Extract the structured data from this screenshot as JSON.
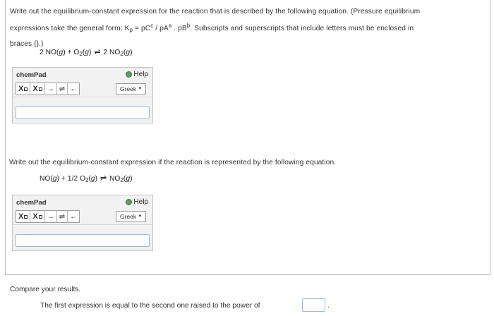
{
  "question1": {
    "part1": "Write out the equilibrium-constant expression for the reaction that is described by the following equation. (Pressure equilibrium",
    "part2_prefix": "expressions take the general form: K",
    "kp_sub": "p",
    "part2_eq": " = pC",
    "c_sup": "c",
    "part2_mid": " / pA",
    "a_sup": "a",
    "part2_mid2": " . pB",
    "b_sup": "b",
    "part2_suffix": ". Subscripts and superscripts that include letters must be enclosed in",
    "part3": "braces {}.)"
  },
  "equation1": {
    "left": "2 NO(",
    "g1": "g",
    "mid1": ") + O",
    "sub1": "2",
    "mid2": "(",
    "g2": "g",
    "mid3": ")",
    "arrow": "⇌",
    "right": " 2 NO",
    "sub2": "2",
    "mid4": "(",
    "g3": "g",
    "end": ")"
  },
  "question2": {
    "text": "Write out the equilibrium-constant expression if the reaction is represented by the following equation."
  },
  "equation2": {
    "left": "NO(",
    "g1": "g",
    "mid1": ") + 1/2 O",
    "sub1": "2",
    "mid2": "(",
    "g2": "g",
    "mid3": ")",
    "arrow": "⇌",
    "right": " NO",
    "sub2": "2",
    "mid4": "(",
    "g3": "g",
    "end": ")"
  },
  "chempad": {
    "title": "chemPad",
    "help_label": "Help",
    "sub_label": "X",
    "sup_label": "X",
    "right_arrow": "→",
    "eq_arrow": "⇌",
    "left_arrow": "←",
    "greek_label": "Greek",
    "greek_caret": "▼"
  },
  "compare": {
    "text": "Compare your results.",
    "final_text": "The first expression is equal to the second one raised to the power of",
    "period": "."
  }
}
